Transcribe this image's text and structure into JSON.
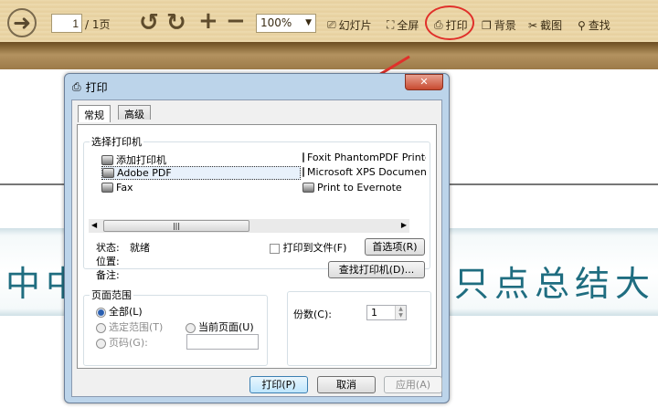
{
  "toolbar": {
    "page_value": "1",
    "page_total": "/ 1页",
    "zoom": "100%",
    "slideshow": "幻灯片",
    "fullscreen": "全屏",
    "print": "打印",
    "background": "背景",
    "screenshot": "截图",
    "find": "查找"
  },
  "document": {
    "text_left": "中中",
    "text_right": "只点总结大"
  },
  "dialog": {
    "title": "打印",
    "close": "✕",
    "tabs": [
      "常规",
      "高级"
    ],
    "printer_group": "选择打印机",
    "printers": [
      "添加打印机",
      "Adobe PDF",
      "Fax",
      "Foxit PhantomPDF Printer",
      "Microsoft XPS Document Writer",
      "Print to Evernote"
    ],
    "status_label": "状态:",
    "status_value": "就绪",
    "location_label": "位置:",
    "comment_label": "备注:",
    "print_to_file": "打印到文件(F)",
    "preferences": "首选项(R)",
    "find_printer": "查找打印机(D)...",
    "range_group": "页面范围",
    "range_all": "全部(L)",
    "range_selection": "选定范围(T)",
    "range_current": "当前页面(U)",
    "range_pages": "页码(G):",
    "copies_label": "份数(C):",
    "copies_value": "1",
    "print_btn": "打印(P)",
    "cancel_btn": "取消",
    "apply_btn": "应用(A)"
  },
  "colors": {
    "annotation": "#e0302a",
    "banner_text": "#1f6d80"
  }
}
